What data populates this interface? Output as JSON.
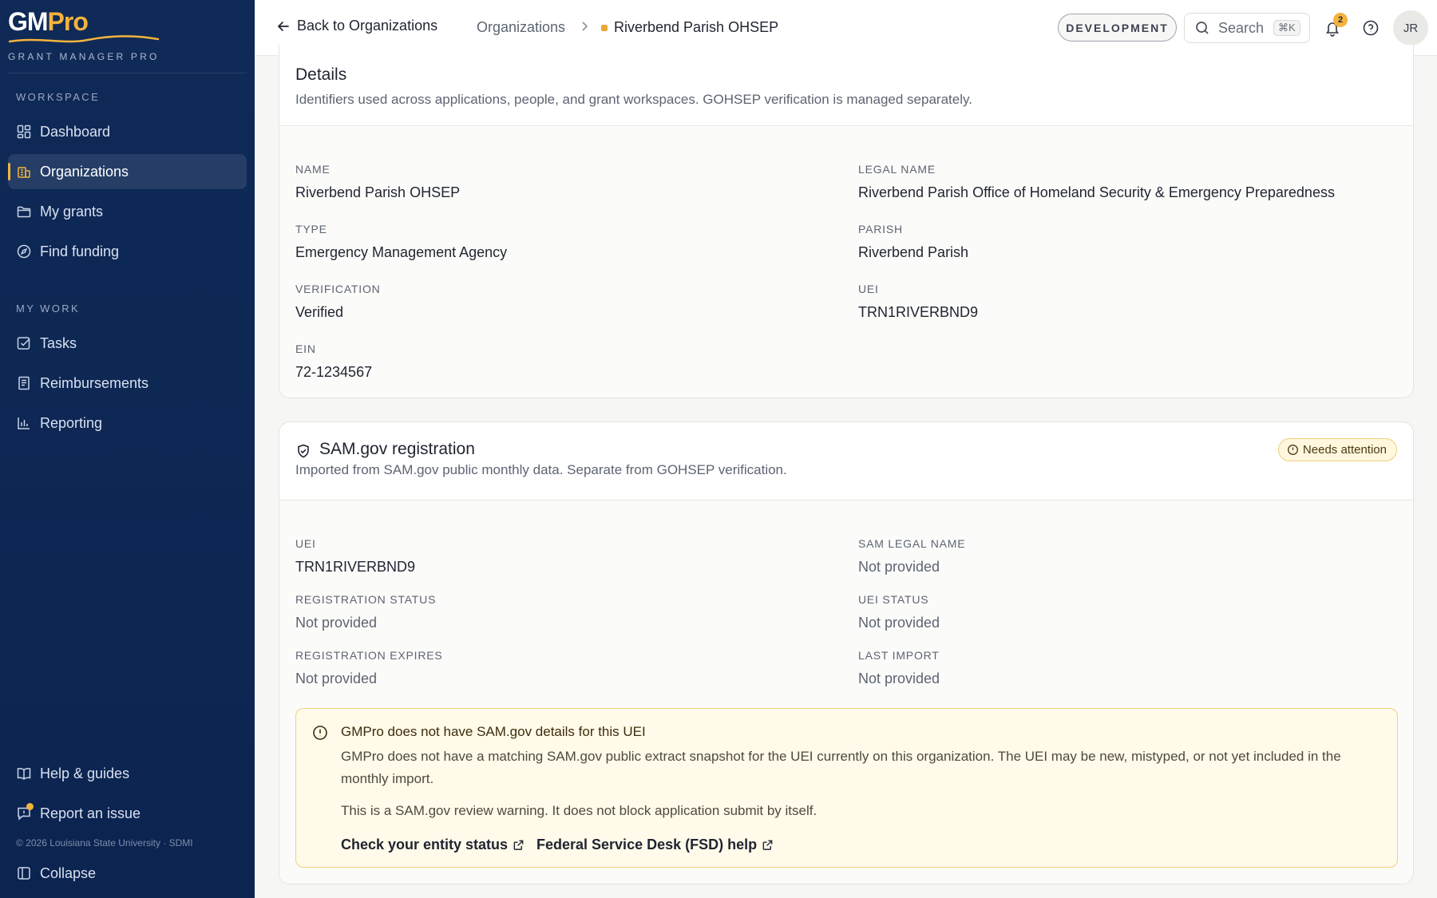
{
  "app": {
    "logo_gm": "GM",
    "logo_pro": "Pro",
    "tagline": "GRANT MANAGER PRO"
  },
  "sidebar": {
    "workspace_label": "WORKSPACE",
    "mywork_label": "MY WORK",
    "items": [
      {
        "label": "Dashboard",
        "icon": "dashboard-icon"
      },
      {
        "label": "Organizations",
        "icon": "building-icon",
        "active": true
      },
      {
        "label": "My grants",
        "icon": "folder-icon"
      },
      {
        "label": "Find funding",
        "icon": "compass-icon"
      },
      {
        "label": "Tasks",
        "icon": "checkbox-icon"
      },
      {
        "label": "Reimbursements",
        "icon": "receipt-icon"
      },
      {
        "label": "Reporting",
        "icon": "bar-chart-icon"
      }
    ],
    "bottom": {
      "help": "Help & guides",
      "report": "Report an issue",
      "copyright": "© 2026 Louisiana State University · SDMI",
      "collapse": "Collapse"
    }
  },
  "topbar": {
    "back": "Back to Organizations",
    "breadcrumb_parent": "Organizations",
    "breadcrumb_current": "Riverbend Parish OHSEP",
    "env": "DEVELOPMENT",
    "search_placeholder": "Search",
    "search_shortcut": "⌘K",
    "notifications_count": "2",
    "avatar_initials": "JR"
  },
  "details": {
    "title": "Details",
    "subtitle": "Identifiers used across applications, people, and grant workspaces. GOHSEP verification is managed separately.",
    "fields": [
      {
        "label": "NAME",
        "value": "Riverbend Parish OHSEP"
      },
      {
        "label": "LEGAL NAME",
        "value": "Riverbend Parish Office of Homeland Security & Emergency Preparedness"
      },
      {
        "label": "TYPE",
        "value": "Emergency Management Agency"
      },
      {
        "label": "PARISH",
        "value": "Riverbend Parish"
      },
      {
        "label": "VERIFICATION",
        "value": "Verified"
      },
      {
        "label": "UEI",
        "value": "TRN1RIVERBND9"
      },
      {
        "label": "EIN",
        "value": "72-1234567"
      }
    ]
  },
  "sam": {
    "title": "SAM.gov registration",
    "subtitle": "Imported from SAM.gov public monthly data. Separate from GOHSEP verification.",
    "status_badge": "Needs attention",
    "fields": [
      {
        "label": "UEI",
        "value": "TRN1RIVERBND9"
      },
      {
        "label": "SAM LEGAL NAME",
        "value": "Not provided"
      },
      {
        "label": "REGISTRATION STATUS",
        "value": "Not provided"
      },
      {
        "label": "UEI STATUS",
        "value": "Not provided"
      },
      {
        "label": "REGISTRATION EXPIRES",
        "value": "Not provided"
      },
      {
        "label": "LAST IMPORT",
        "value": "Not provided"
      }
    ],
    "warning": {
      "title": "GMPro does not have SAM.gov details for this UEI",
      "text": "GMPro does not have a matching SAM.gov public extract snapshot for the UEI currently on this organization. The UEI may be new, mistyped, or not yet included in the monthly import.",
      "text2": "This is a SAM.gov review warning. It does not block application submit by itself.",
      "link1": "Check your entity status",
      "link2": "Federal Service Desk (FSD) help"
    }
  },
  "colors": {
    "sidebar_bg": "#0f2a57",
    "accent": "#f3b33d",
    "warning_bg": "#fffaea",
    "warning_border": "#f1d27e"
  }
}
